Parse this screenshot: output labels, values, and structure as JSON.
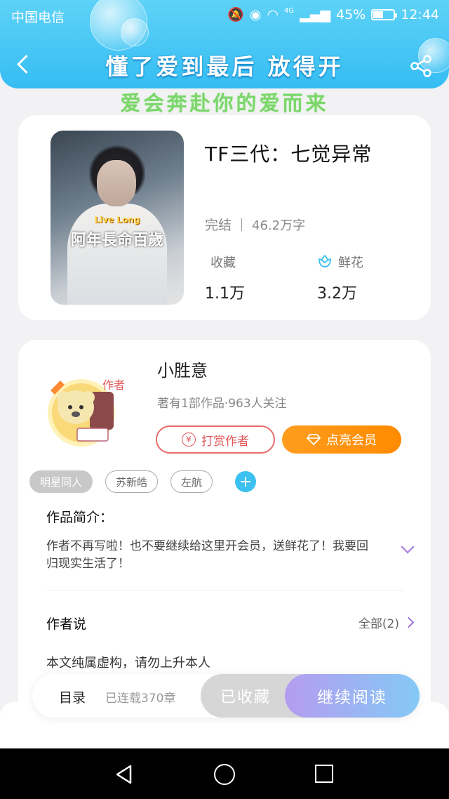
{
  "status_bar": {
    "carrier": "中国电信",
    "network": "4G",
    "battery": "45%",
    "time": "12:44"
  },
  "header": {
    "title": "懂了爱到最后 放得开",
    "subtitle": "爱会奔赴你的爱而来"
  },
  "book": {
    "title": "TF三代：七觉异常",
    "status": "完结",
    "word_count": "46.2万字",
    "favorites_label": "收藏",
    "favorites_value": "1.1万",
    "flowers_label": "鲜花",
    "flowers_value": "3.2万",
    "cover_text_en": "Live Long",
    "cover_text_cn": "阿年長命百歲"
  },
  "author": {
    "name": "小胜意",
    "meta": "著有1部作品·963人关注",
    "badge": "作者",
    "tip_label": "打赏作者",
    "vip_label": "点亮会员"
  },
  "tags": [
    "明星同人",
    "苏新皓",
    "左航"
  ],
  "intro": {
    "label": "作品简介：",
    "text": "作者不再写啦！也不要继续给这里开会员，送鲜花了！我要回归现实生活了！"
  },
  "author_says": {
    "label": "作者说",
    "all_label": "全部(2)",
    "text": "本文纯属虚构，请勿上升本人"
  },
  "action_bar": {
    "toc_label": "目录",
    "serial_label": "已连载370章",
    "collected_label": "已收藏",
    "read_label": "继续阅读"
  },
  "colors": {
    "header": "#35bdf3",
    "subtitle": "#7bd66b",
    "vip": "#ff8a00",
    "tip": "#e05858",
    "accent_purple": "#9a72d8"
  }
}
